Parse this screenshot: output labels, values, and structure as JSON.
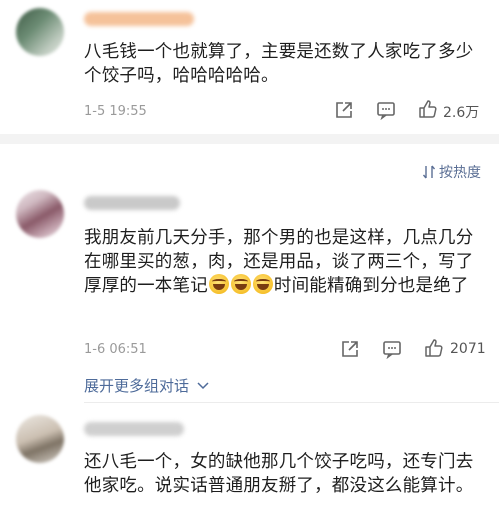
{
  "comments": [
    {
      "text": "八毛钱一个也就算了，主要是还数了人家吃了多少个饺子吗，哈哈哈哈哈。",
      "time": "1-5 19:55",
      "likes": "2.6万"
    },
    {
      "text_before_emoji": "我朋友前几天分手，那个男的也是这样，几点几分在哪里买的葱，肉，还是用品，谈了两三个，写了厚厚的一本笔记",
      "text_after_emoji": "时间能精确到分也是绝了",
      "time": "1-6 06:51",
      "likes": "2071",
      "expand_label": "展开更多组对话"
    },
    {
      "text": "还八毛一个，女的缺他那几个饺子吃吗，还专门去他家吃。说实话普通朋友掰了，都没这么能算计。"
    }
  ],
  "sort": {
    "label": "按热度",
    "icon": "sort-arrows-icon"
  },
  "icons": {
    "share": "share-icon",
    "comment": "comment-icon",
    "like": "thumbs-up-icon",
    "expand": "chevron-down-icon"
  },
  "colors": {
    "link": "#4e6b9a",
    "timestamp": "#9a9a9a",
    "divider": "#f3f3f3"
  }
}
